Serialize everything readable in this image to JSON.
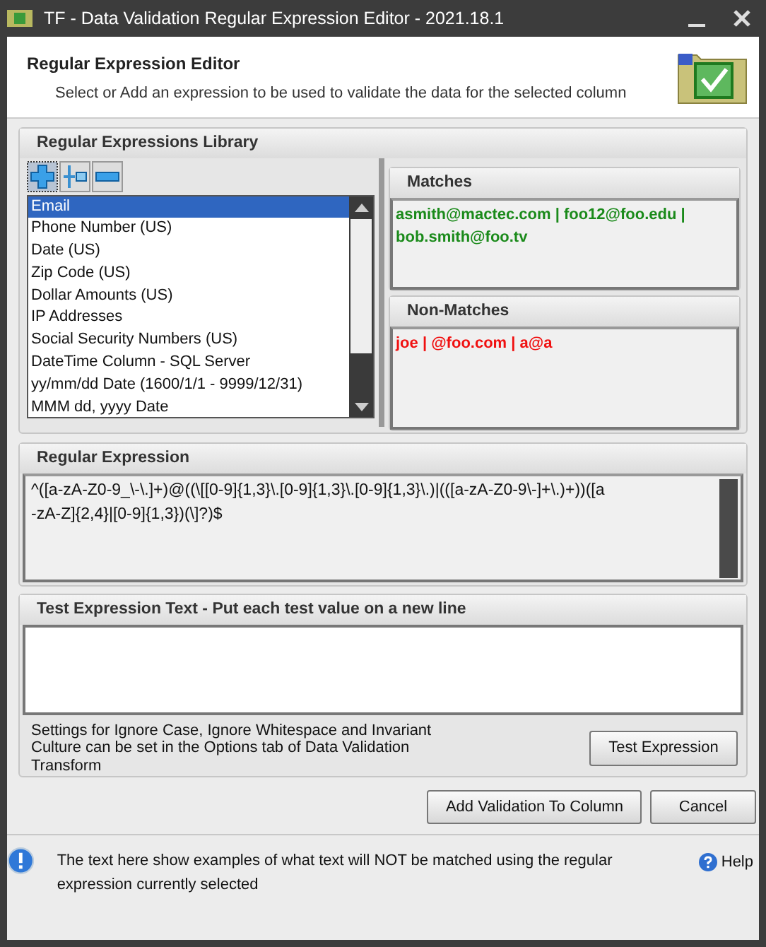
{
  "window": {
    "title": "TF - Data Validation Regular Expression Editor - 2021.18.1"
  },
  "header": {
    "title": "Regular Expression Editor",
    "subtitle": "Select or Add an expression to be used to validate the data for the selected column"
  },
  "library": {
    "title": "Regular Expressions Library",
    "items": [
      {
        "label": "Email",
        "selected": true
      },
      {
        "label": "Phone Number (US)",
        "selected": false
      },
      {
        "label": "Date (US)",
        "selected": false
      },
      {
        "label": "Zip Code (US)",
        "selected": false
      },
      {
        "label": "Dollar Amounts (US)",
        "selected": false
      },
      {
        "label": "IP Addresses",
        "selected": false
      },
      {
        "label": "Social Security Numbers (US)",
        "selected": false
      },
      {
        "label": "DateTime Column - SQL Server",
        "selected": false
      },
      {
        "label": "yy/mm/dd Date (1600/1/1 - 9999/12/31)",
        "selected": false
      },
      {
        "label": "MMM dd, yyyy Date",
        "selected": false
      }
    ]
  },
  "matches": {
    "title": "Matches",
    "text": "asmith@mactec.com | foo12@foo.edu | bob.smith@foo.tv"
  },
  "non_matches": {
    "title": "Non-Matches",
    "text": "joe | @foo.com | a@a"
  },
  "regular_expression": {
    "title": "Regular Expression",
    "value": "^([a-zA-Z0-9_\\-\\.]+)@((\\[[0-9]{1,3}\\.[0-9]{1,3}\\.[0-9]{1,3}\\.)|(([a-zA-Z0-9\\-]+\\.)+))([a-zA-Z]{2,4}|[0-9]{1,3})(\\]?)$"
  },
  "test": {
    "title": "Test Expression Text - Put each test value on a new line",
    "note": "Settings for Ignore Case, Ignore Whitespace and Invariant Culture can be set in the Options tab of Data Validation Transform",
    "button": "Test Expression"
  },
  "buttons": [
    "Add Validation To Column",
    "Cancel"
  ],
  "info": {
    "text": "The text here show examples of what text will NOT be matched using the regular expression currently selected",
    "help": "Help"
  }
}
